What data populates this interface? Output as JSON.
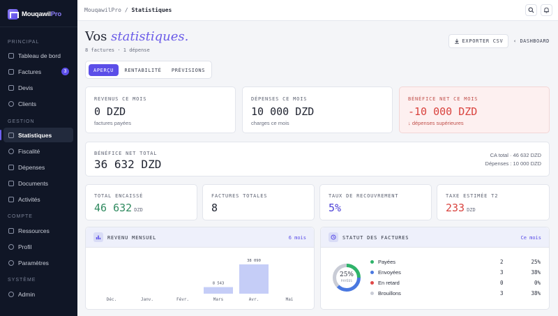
{
  "app": {
    "logo_main": "Mouqawil",
    "logo_accent": "Pro"
  },
  "sidebar": {
    "sections": [
      "PRINCIPAL",
      "GESTION",
      "COMPTE",
      "SYSTÈME"
    ],
    "items": [
      {
        "label": "Tableau de bord"
      },
      {
        "label": "Factures",
        "badge": "3"
      },
      {
        "label": "Devis"
      },
      {
        "label": "Clients"
      },
      {
        "label": "Statistiques"
      },
      {
        "label": "Fiscalité"
      },
      {
        "label": "Dépenses"
      },
      {
        "label": "Documents"
      },
      {
        "label": "Activités"
      },
      {
        "label": "Ressources"
      },
      {
        "label": "Profil"
      },
      {
        "label": "Paramètres"
      },
      {
        "label": "Admin"
      }
    ]
  },
  "topbar": {
    "crumb_root": "MouqawilPro",
    "crumb_sep": "/",
    "crumb_current": "Statistiques"
  },
  "header": {
    "title_plain": "Vos ",
    "title_accent": "statistiques.",
    "subtitle": "8 factures · 1 dépense",
    "export_label": "EXPORTER CSV",
    "dashboard_label": "DASHBOARD"
  },
  "tabs": [
    "APERÇU",
    "RENTABILITÉ",
    "PRÉVISIONS"
  ],
  "kpis_top": [
    {
      "label": "REVENUS CE MOIS",
      "value": "0 DZD",
      "note": "factures payées"
    },
    {
      "label": "DÉPENSES CE MOIS",
      "value": "10 000 DZD",
      "note": "charges ce mois"
    },
    {
      "label": "BÉNÉFICE NET CE MOIS",
      "value": "-10 000 DZD",
      "note": "↓ dépenses supérieures"
    }
  ],
  "total": {
    "label": "BÉNÉFICE NET TOTAL",
    "value": "36 632 DZD",
    "ca_total": "CA total · 46 632 DZD",
    "depenses": "Dépenses : 10 000 DZD"
  },
  "kpis_bottom": [
    {
      "label": "TOTAL ENCAISSÉ",
      "value": "46 632",
      "unit": "DZD",
      "color": "#2f8a5f"
    },
    {
      "label": "FACTURES TOTALES",
      "value": "8",
      "unit": "",
      "color": "#1f2330"
    },
    {
      "label": "TAUX DE RECOUVREMENT",
      "value": "5%",
      "unit": "",
      "color": "#4b3fd6"
    },
    {
      "label": "TAXE ESTIMÉE T2",
      "value": "233",
      "unit": "DZD",
      "color": "#d9433e"
    }
  ],
  "revenue_chart": {
    "title": "REVENU MENSUEL",
    "period": "6 mois"
  },
  "chart_data": {
    "type": "bar",
    "categories": [
      "Déc.",
      "Janv.",
      "Févr.",
      "Mars",
      "Avr.",
      "Mai"
    ],
    "values": [
      0,
      0,
      0,
      8543,
      38090,
      0
    ],
    "data_labels": [
      "",
      "",
      "",
      "8 543",
      "38 090",
      ""
    ],
    "color": "#c5cdf7"
  },
  "status_chart": {
    "title": "STATUT DES FACTURES",
    "period": "Ce mois",
    "donut_value": "25%",
    "donut_label": "PAYÉES",
    "rows": [
      {
        "label": "Payées",
        "count": "2",
        "pct": "25%",
        "color": "#2fb36a"
      },
      {
        "label": "Envoyées",
        "count": "3",
        "pct": "38%",
        "color": "#4a78e0"
      },
      {
        "label": "En retard",
        "count": "0",
        "pct": "0%",
        "color": "#e04848"
      },
      {
        "label": "Brouillons",
        "count": "3",
        "pct": "38%",
        "color": "#c9ccd6"
      }
    ]
  }
}
